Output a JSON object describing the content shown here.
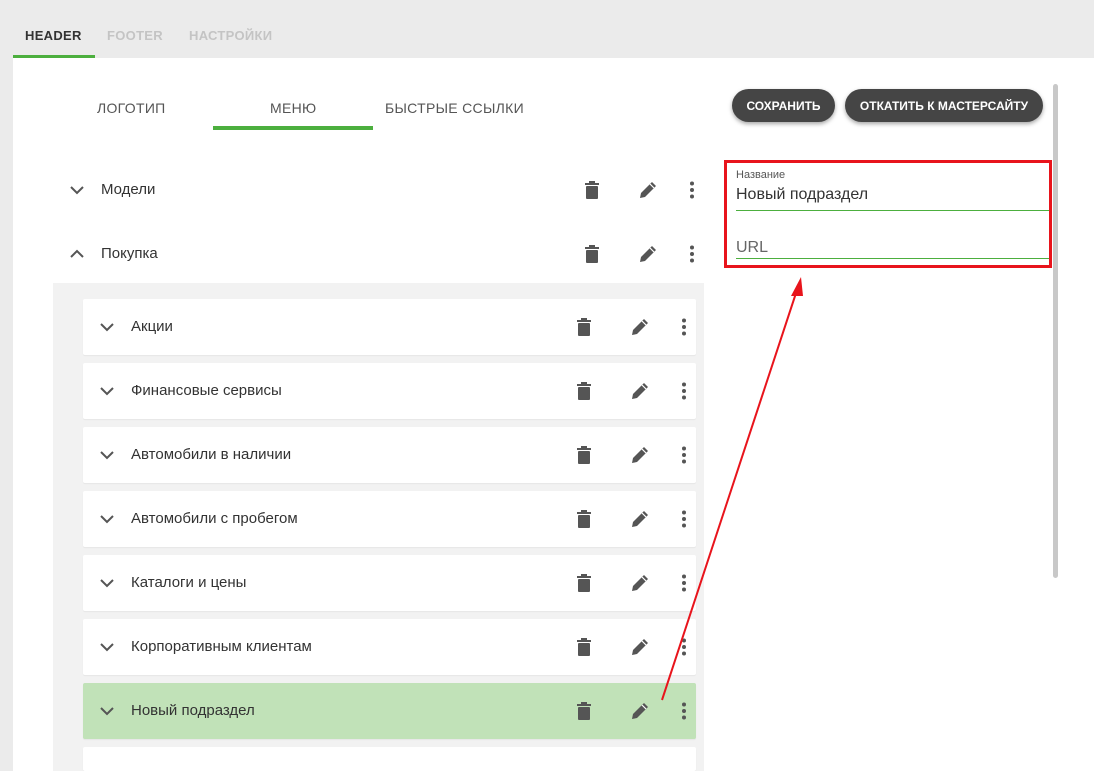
{
  "top_tabs": [
    {
      "label": "HEADER"
    },
    {
      "label": "FOOTER"
    },
    {
      "label": "НАСТРОЙКИ"
    }
  ],
  "sub_tabs": [
    {
      "label": "ЛОГОТИП"
    },
    {
      "label": "МЕНЮ"
    },
    {
      "label": "БЫСТРЫЕ ССЫЛКИ"
    }
  ],
  "buttons": {
    "save": "СОХРАНИТЬ",
    "rollback": "ОТКАТИТЬ К МАСТЕРСАЙТУ"
  },
  "menu": {
    "top_items": [
      {
        "label": "Модели",
        "expanded": false
      },
      {
        "label": "Покупка",
        "expanded": true
      }
    ],
    "children": [
      {
        "label": "Акции"
      },
      {
        "label": "Финансовые сервисы"
      },
      {
        "label": "Автомобили в наличии"
      },
      {
        "label": "Автомобили с пробегом"
      },
      {
        "label": "Каталоги и цены"
      },
      {
        "label": "Корпоративным клиентам"
      },
      {
        "label": "Новый подраздел",
        "selected": true
      }
    ]
  },
  "form": {
    "name_label": "Название",
    "name_value": "Новый подраздел",
    "url_placeholder": "URL"
  },
  "icons": {
    "delete": "trash-icon",
    "edit": "pencil-icon",
    "more": "more-vertical-icon",
    "expand": "chevron-down-icon",
    "collapse": "chevron-up-icon"
  },
  "colors": {
    "accent": "#4caf3e",
    "selected_row": "#c1e2b8",
    "highlight_box": "#e8141c",
    "button_bg": "#454545"
  }
}
